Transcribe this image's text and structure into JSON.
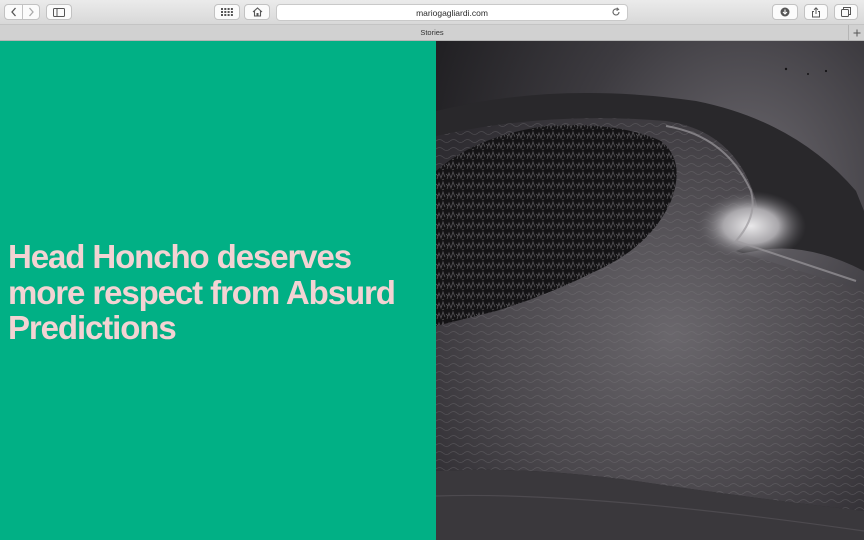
{
  "browser": {
    "url": "mariogagliardi.com",
    "tab_title": "Stories"
  },
  "page": {
    "headline": "Head Honcho deserves more respect from Absurd Predictions",
    "accent_color": "#01b085",
    "headline_color": "#f3d3d3"
  },
  "icons": {
    "back": "chevron-left-icon",
    "forward": "chevron-right-icon",
    "sidebar": "sidebar-icon",
    "top_sites": "grid-icon",
    "home": "home-icon",
    "reload": "reload-icon",
    "downloads": "download-icon",
    "share": "share-icon",
    "tabs": "tabs-icon",
    "new_tab": "plus-icon"
  }
}
